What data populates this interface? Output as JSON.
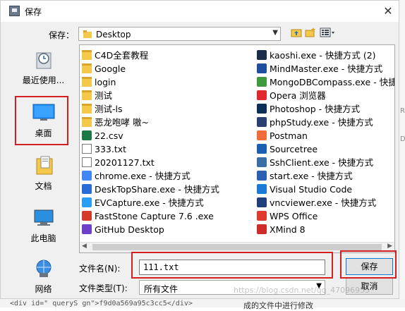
{
  "dialog": {
    "title": "保存",
    "close_glyph": "✕"
  },
  "toolbar": {
    "save_in_label": "保存：",
    "location": "Desktop",
    "combo_arrow": "▼"
  },
  "places": [
    {
      "name": "recent",
      "label": "最近使用..."
    },
    {
      "name": "desktop",
      "label": "桌面"
    },
    {
      "name": "documents",
      "label": "文档"
    },
    {
      "name": "this-pc",
      "label": "此电脑"
    },
    {
      "name": "network",
      "label": "网络"
    }
  ],
  "files_col1": [
    {
      "name": "C4D全套教程",
      "icon": "folder"
    },
    {
      "name": "Google",
      "icon": "folder"
    },
    {
      "name": "login",
      "icon": "folder"
    },
    {
      "name": "测试",
      "icon": "folder"
    },
    {
      "name": "测试-ls",
      "icon": "folder"
    },
    {
      "name": "恶龙咆哮 嗷~",
      "icon": "folder"
    },
    {
      "name": "22.csv",
      "icon": "excel"
    },
    {
      "name": "333.txt",
      "icon": "file"
    },
    {
      "name": "20201127.txt",
      "icon": "file"
    },
    {
      "name": "chrome.exe - 快捷方式",
      "icon": "chrome"
    },
    {
      "name": "DeskTopShare.exe - 快捷方式",
      "icon": "desktopshare"
    },
    {
      "name": "EVCapture.exe - 快捷方式",
      "icon": "evcapture"
    },
    {
      "name": "FastStone Capture 7.6 .exe",
      "icon": "faststone"
    },
    {
      "name": "GitHub Desktop",
      "icon": "github"
    }
  ],
  "files_col2": [
    {
      "name": "kaoshi.exe - 快捷方式 (2)",
      "icon": "kaoshi"
    },
    {
      "name": "MindMaster.exe - 快捷方式",
      "icon": "mindmaster"
    },
    {
      "name": "MongoDBCompass.exe - 快捷",
      "icon": "mongodb"
    },
    {
      "name": "Opera 浏览器",
      "icon": "opera"
    },
    {
      "name": "Photoshop - 快捷方式",
      "icon": "photoshop"
    },
    {
      "name": "phpStudy.exe - 快捷方式",
      "icon": "phpstudy"
    },
    {
      "name": "Postman",
      "icon": "postman"
    },
    {
      "name": "Sourcetree",
      "icon": "sourcetree"
    },
    {
      "name": "SshClient.exe - 快捷方式",
      "icon": "sshclient"
    },
    {
      "name": "start.exe - 快捷方式",
      "icon": "start"
    },
    {
      "name": "Visual Studio Code",
      "icon": "vscode"
    },
    {
      "name": "vncviewer.exe - 快捷方式",
      "icon": "vnc"
    },
    {
      "name": "WPS Office",
      "icon": "wps"
    },
    {
      "name": "XMind 8",
      "icon": "xmind"
    }
  ],
  "form": {
    "filename_label": "文件名(N):",
    "filename_value": "111.txt",
    "filetype_label": "文件类型(T):",
    "filetype_value": "所有文件",
    "save_button": "保存",
    "cancel_button": "取消"
  },
  "background": {
    "code_snippet": "<div id=\"  queryS gn\">f9d0a569a95c3cc5</div>",
    "text_snippet": "成的文件中进行修改",
    "watermark": "https://blog.csdn.net/qq_47096955"
  },
  "icon_colors": {
    "folder": "#f3c84b",
    "excel": "#1d7a44",
    "chrome": "#4285f4",
    "desktopshare": "#2a6cd6",
    "evcapture": "#2a9df4",
    "faststone": "#d43a2a",
    "github": "#6e40c9",
    "kaoshi": "#1c2d4a",
    "mindmaster": "#1f4e9e",
    "mongodb": "#3f9a3f",
    "opera": "#e0282e",
    "photoshop": "#0b2f55",
    "phpstudy": "#2c3f73",
    "postman": "#f26b3a",
    "sourcetree": "#1b5fb0",
    "sshclient": "#3a6ea5",
    "start": "#2b5fb4",
    "vscode": "#1a7ad6",
    "vnc": "#1f3f7a",
    "wps": "#e03a2f",
    "xmind": "#cf2b2b",
    "highlight_red": "#d21f1f"
  }
}
